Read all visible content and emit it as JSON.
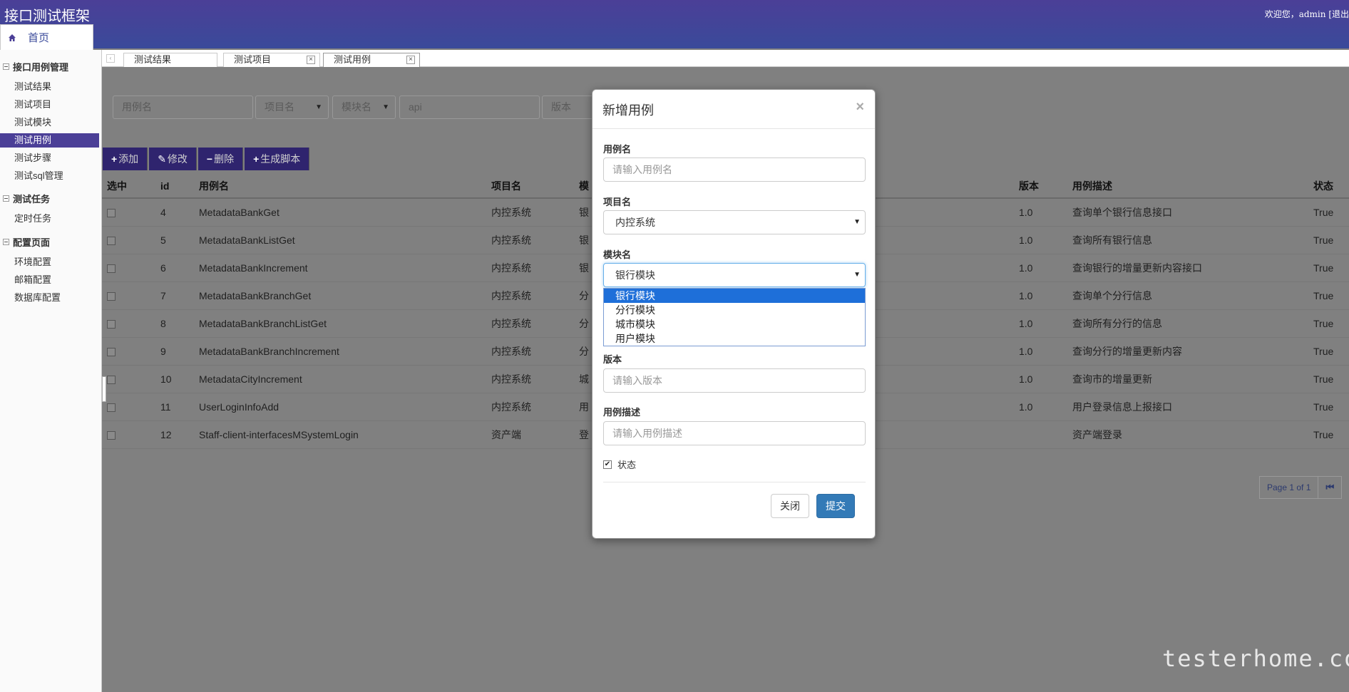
{
  "header": {
    "app_title": "接口测试框架",
    "welcome_text": "欢迎您，admin [退出",
    "home_label": "首页"
  },
  "sidebar": {
    "groups": [
      {
        "label": "接口用例管理",
        "items": [
          "测试结果",
          "测试项目",
          "测试模块",
          "测试用例",
          "测试步骤",
          "测试sql管理"
        ]
      },
      {
        "label": "测试任务",
        "items": [
          "定时任务"
        ]
      },
      {
        "label": "配置页面",
        "items": [
          "环境配置",
          "邮箱配置",
          "数据库配置"
        ]
      }
    ],
    "active_item": "测试用例"
  },
  "tabs": [
    {
      "label": "测试结果"
    },
    {
      "label": "测试项目"
    },
    {
      "label": "测试用例"
    }
  ],
  "filters": {
    "case_name_placeholder": "用例名",
    "project_select": "项目名",
    "module_select": "模块名",
    "api_placeholder": "api",
    "version_placeholder": "版本"
  },
  "toolbar": {
    "add": "添加",
    "edit": "修改",
    "delete": "删除",
    "generate": "生成脚本"
  },
  "table": {
    "headers": [
      "选中",
      "id",
      "用例名",
      "项目名",
      "模",
      "版本",
      "用例描述",
      "状态"
    ],
    "rows": [
      {
        "id": "4",
        "name": "MetadataBankGet",
        "project": "内控系统",
        "module": "银",
        "version": "1.0",
        "desc": "查询单个银行信息接口",
        "status": "True"
      },
      {
        "id": "5",
        "name": "MetadataBankListGet",
        "project": "内控系统",
        "module": "银",
        "version": "1.0",
        "desc": "查询所有银行信息",
        "status": "True"
      },
      {
        "id": "6",
        "name": "MetadataBankIncrement",
        "project": "内控系统",
        "module": "银",
        "version": "1.0",
        "desc": "查询银行的增量更新内容接口",
        "status": "True"
      },
      {
        "id": "7",
        "name": "MetadataBankBranchGet",
        "project": "内控系统",
        "module": "分",
        "version": "1.0",
        "desc": "查询单个分行信息",
        "status": "True"
      },
      {
        "id": "8",
        "name": "MetadataBankBranchListGet",
        "project": "内控系统",
        "module": "分",
        "version": "1.0",
        "desc": "查询所有分行的信息",
        "status": "True"
      },
      {
        "id": "9",
        "name": "MetadataBankBranchIncrement",
        "project": "内控系统",
        "module": "分",
        "version": "1.0",
        "desc": "查询分行的增量更新内容",
        "status": "True"
      },
      {
        "id": "10",
        "name": "MetadataCityIncrement",
        "project": "内控系统",
        "module": "城",
        "version": "1.0",
        "desc": "查询市的增量更新",
        "status": "True"
      },
      {
        "id": "11",
        "name": "UserLoginInfoAdd",
        "project": "内控系统",
        "module": "用",
        "version": "1.0",
        "desc": "用户登录信息上报接口",
        "status": "True"
      },
      {
        "id": "12",
        "name": "Staff-client-interfacesMSystemLogin",
        "project": "资产端",
        "module": "登",
        "version": "",
        "desc": "资产端登录",
        "status": "True"
      }
    ]
  },
  "pager": {
    "text": "Page 1 of 1"
  },
  "modal": {
    "title": "新增用例",
    "close_symbol": "×",
    "case_name_label": "用例名",
    "case_name_placeholder": "请输入用例名",
    "project_label": "项目名",
    "project_value": "内控系统",
    "module_label": "模块名",
    "module_value": "银行模块",
    "module_options": [
      "银行模块",
      "分行模块",
      "城市模块",
      "用户模块"
    ],
    "version_label": "版本",
    "version_placeholder": "请输入版本",
    "desc_label": "用例描述",
    "desc_placeholder": "请输入用例描述",
    "status_label": "状态",
    "status_checked": true,
    "close_button": "关闭",
    "submit_button": "提交"
  },
  "watermark": "testerhome.com"
}
